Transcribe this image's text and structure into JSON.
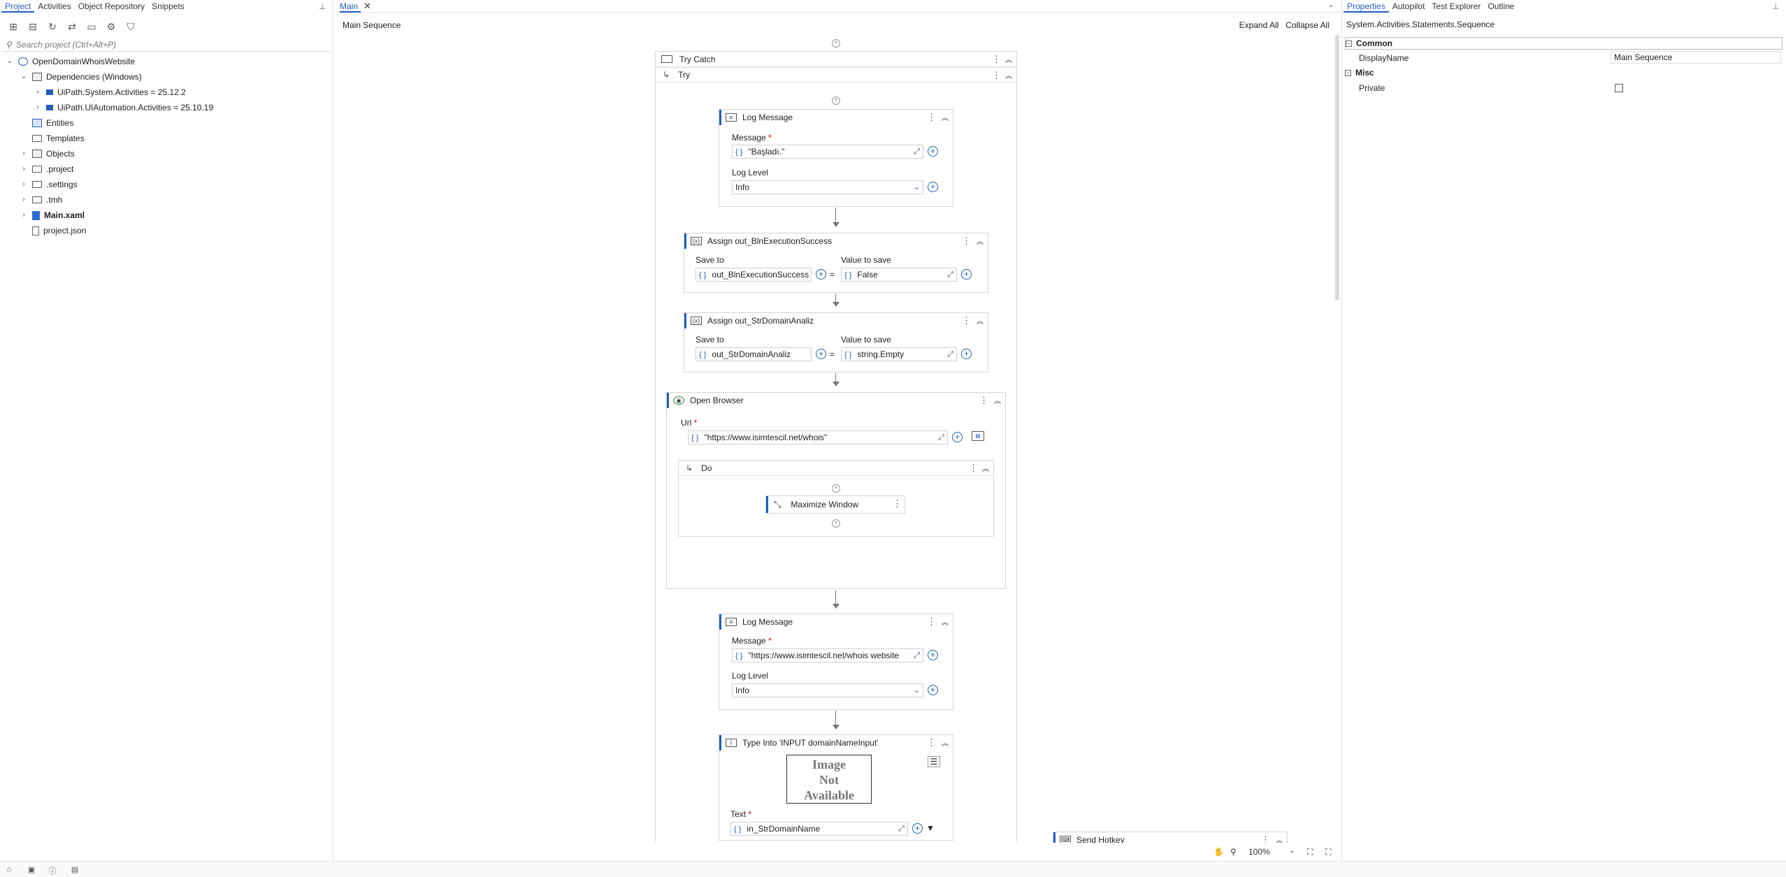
{
  "left_panel": {
    "tabs": [
      "Project",
      "Activities",
      "Object Repository",
      "Snippets"
    ],
    "search_placeholder": "Search project (Ctrl+Alt+P)",
    "tree": {
      "root": "OpenDomainWhoisWebsite",
      "dependencies": "Dependencies (Windows)",
      "dep1": "UiPath.System.Activities = 25.12.2",
      "dep2": "UiPath.UIAutomation.Activities = 25.10.19",
      "entities": "Entities",
      "templates": "Templates",
      "objects": "Objects",
      "project_folder": ".project",
      "settings_folder": ".settings",
      "tmh_folder": ".tmh",
      "main_xaml": "Main.xaml",
      "project_json": "project.json"
    }
  },
  "designer": {
    "tab_label": "Main",
    "breadcrumb": "Main Sequence",
    "expand_all": "Expand All",
    "collapse_all": "Collapse All",
    "zoom": "100%",
    "try_catch": "Try Catch",
    "try": "Try",
    "log1": {
      "title": "Log Message",
      "message_label": "Message",
      "message_value": "\"Başladı.\"",
      "level_label": "Log Level",
      "level_value": "Info"
    },
    "assign1": {
      "title": "Assign out_BlnExecutionSuccess",
      "save_label": "Save to",
      "save_value": "out_BlnExecutionSuccess",
      "value_label": "Value to save",
      "value_value": "False"
    },
    "assign2": {
      "title": "Assign out_StrDomainAnaliz",
      "save_label": "Save to",
      "save_value": "out_StrDomainAnaliz",
      "value_label": "Value to save",
      "value_value": "string.Empty"
    },
    "open_browser": {
      "title": "Open Browser",
      "url_label": "Url",
      "url_value": "\"https://www.isimtescil.net/whois\"",
      "do_label": "Do",
      "maximize": "Maximize Window"
    },
    "log2": {
      "title": "Log Message",
      "message_label": "Message",
      "message_value": "\"https://www.isimtescil.net/whois website",
      "level_label": "Log Level",
      "level_value": "Info"
    },
    "type_into": {
      "title": "Type Into 'INPUT  domainNameInput'",
      "image_na": "Image Not Available",
      "text_label": "Text",
      "text_value": "in_StrDomainName"
    },
    "send_hotkey": "Send Hotkey"
  },
  "properties": {
    "tabs": [
      "Properties",
      "Autopilot",
      "Test Explorer",
      "Outline"
    ],
    "type_name": "System.Activities.Statements.Sequence",
    "sections": {
      "common": "Common",
      "misc": "Misc"
    },
    "display_name_label": "DisplayName",
    "display_name_value": "Main Sequence",
    "private_label": "Private",
    "private_checked": false
  }
}
